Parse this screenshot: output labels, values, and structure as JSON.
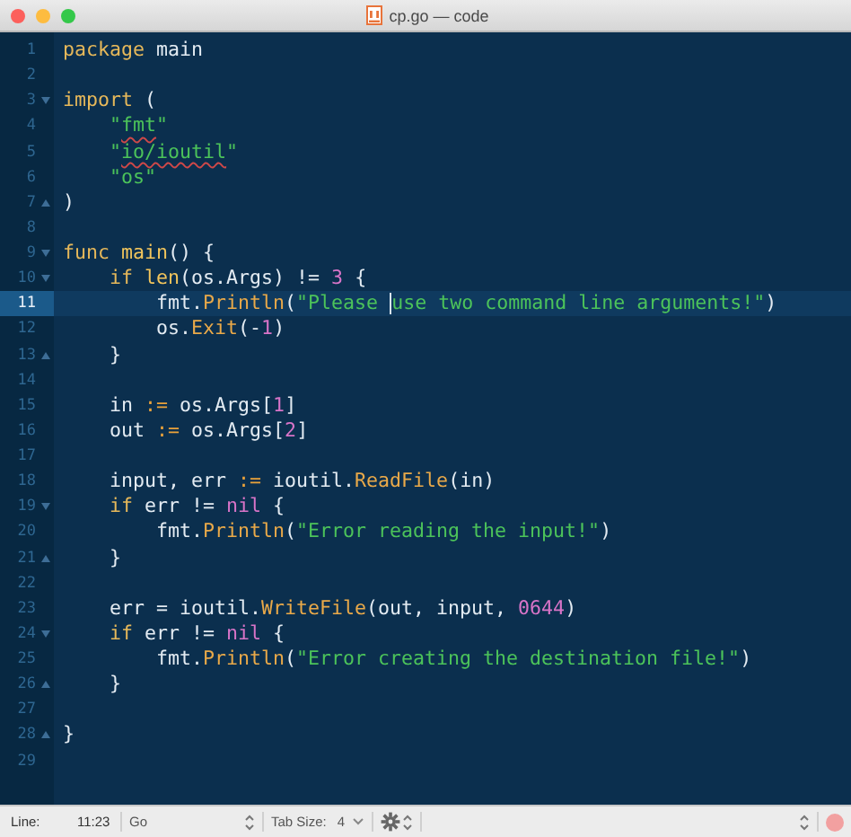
{
  "window": {
    "title": "cp.go — code",
    "controls": [
      {
        "kind": "close"
      },
      {
        "kind": "minimize"
      },
      {
        "kind": "zoom"
      }
    ]
  },
  "editor": {
    "lines": [
      {
        "number": "1",
        "selected": false,
        "tokens": [
          {
            "kind": "keyword",
            "text": "package"
          },
          {
            "kind": "plain",
            "text": " main"
          }
        ]
      },
      {
        "number": "2",
        "selected": false
      },
      {
        "number": "3",
        "selected": false,
        "fold_marker": {
          "kind": "start"
        },
        "tokens": [
          {
            "kind": "keyword",
            "text": "import"
          },
          {
            "kind": "plain",
            "text": " ("
          }
        ]
      },
      {
        "number": "4",
        "selected": false,
        "tokens": [
          {
            "kind": "string",
            "text": "    \""
          },
          {
            "kind": "string-flagged",
            "text": "fmt"
          },
          {
            "kind": "string",
            "text": "\""
          }
        ]
      },
      {
        "number": "5",
        "selected": false,
        "tokens": [
          {
            "kind": "string",
            "text": "    \""
          },
          {
            "kind": "string-flagged",
            "text": "io/ioutil"
          },
          {
            "kind": "string",
            "text": "\""
          }
        ]
      },
      {
        "number": "6",
        "selected": false,
        "tokens": [
          {
            "kind": "string",
            "text": "    \"os\""
          }
        ]
      },
      {
        "number": "7",
        "selected": false,
        "fold_marker": {
          "kind": "end"
        },
        "tokens": [
          {
            "kind": "plain",
            "text": ")"
          }
        ]
      },
      {
        "number": "8",
        "selected": false
      },
      {
        "number": "9",
        "selected": false,
        "fold_marker": {
          "kind": "start"
        },
        "tokens": [
          {
            "kind": "keyword",
            "text": "func"
          },
          {
            "kind": "function",
            "text": " main"
          },
          {
            "kind": "plain",
            "text": "() {"
          }
        ]
      },
      {
        "number": "10",
        "selected": false,
        "fold_marker": {
          "kind": "start"
        },
        "tokens": [
          {
            "kind": "keyword",
            "text": "    if"
          },
          {
            "kind": "function",
            "text": " len"
          },
          {
            "kind": "plain",
            "text": "(os.Args) != "
          },
          {
            "kind": "number",
            "text": "3"
          },
          {
            "kind": "plain",
            "text": " {"
          }
        ]
      },
      {
        "number": "11",
        "selected": true,
        "tokens": [
          {
            "kind": "plain",
            "text": "        fmt."
          },
          {
            "kind": "call",
            "text": "Println"
          },
          {
            "kind": "plain",
            "text": "("
          },
          {
            "kind": "string",
            "text": "\"Please "
          },
          {
            "kind": "caret"
          },
          {
            "kind": "string",
            "text": "use two command line arguments!\""
          },
          {
            "kind": "plain",
            "text": ")"
          }
        ]
      },
      {
        "number": "12",
        "selected": false,
        "tokens": [
          {
            "kind": "plain",
            "text": "        os."
          },
          {
            "kind": "call",
            "text": "Exit"
          },
          {
            "kind": "plain",
            "text": "(-"
          },
          {
            "kind": "number",
            "text": "1"
          },
          {
            "kind": "plain",
            "text": ")"
          }
        ]
      },
      {
        "number": "13",
        "selected": false,
        "fold_marker": {
          "kind": "end"
        },
        "tokens": [
          {
            "kind": "plain",
            "text": "    }"
          }
        ]
      },
      {
        "number": "14",
        "selected": false
      },
      {
        "number": "15",
        "selected": false,
        "tokens": [
          {
            "kind": "plain",
            "text": "    in "
          },
          {
            "kind": "operator",
            "text": ":="
          },
          {
            "kind": "plain",
            "text": " os.Args["
          },
          {
            "kind": "number",
            "text": "1"
          },
          {
            "kind": "plain",
            "text": "]"
          }
        ]
      },
      {
        "number": "16",
        "selected": false,
        "tokens": [
          {
            "kind": "plain",
            "text": "    out "
          },
          {
            "kind": "operator",
            "text": ":="
          },
          {
            "kind": "plain",
            "text": " os.Args["
          },
          {
            "kind": "number",
            "text": "2"
          },
          {
            "kind": "plain",
            "text": "]"
          }
        ]
      },
      {
        "number": "17",
        "selected": false
      },
      {
        "number": "18",
        "selected": false,
        "tokens": [
          {
            "kind": "plain",
            "text": "    input, err "
          },
          {
            "kind": "operator",
            "text": ":="
          },
          {
            "kind": "plain",
            "text": " ioutil."
          },
          {
            "kind": "call",
            "text": "ReadFile"
          },
          {
            "kind": "plain",
            "text": "(in)"
          }
        ]
      },
      {
        "number": "19",
        "selected": false,
        "fold_marker": {
          "kind": "start"
        },
        "tokens": [
          {
            "kind": "keyword",
            "text": "    if"
          },
          {
            "kind": "plain",
            "text": " err != "
          },
          {
            "kind": "number",
            "text": "nil"
          },
          {
            "kind": "plain",
            "text": " {"
          }
        ]
      },
      {
        "number": "20",
        "selected": false,
        "tokens": [
          {
            "kind": "plain",
            "text": "        fmt."
          },
          {
            "kind": "call",
            "text": "Println"
          },
          {
            "kind": "plain",
            "text": "("
          },
          {
            "kind": "string",
            "text": "\"Error reading the input!\""
          },
          {
            "kind": "plain",
            "text": ")"
          }
        ]
      },
      {
        "number": "21",
        "selected": false,
        "fold_marker": {
          "kind": "end"
        },
        "tokens": [
          {
            "kind": "plain",
            "text": "    }"
          }
        ]
      },
      {
        "number": "22",
        "selected": false
      },
      {
        "number": "23",
        "selected": false,
        "tokens": [
          {
            "kind": "plain",
            "text": "    err = ioutil."
          },
          {
            "kind": "call",
            "text": "WriteFile"
          },
          {
            "kind": "plain",
            "text": "(out, input, "
          },
          {
            "kind": "number",
            "text": "0644"
          },
          {
            "kind": "plain",
            "text": ")"
          }
        ]
      },
      {
        "number": "24",
        "selected": false,
        "fold_marker": {
          "kind": "start"
        },
        "tokens": [
          {
            "kind": "keyword",
            "text": "    if"
          },
          {
            "kind": "plain",
            "text": " err != "
          },
          {
            "kind": "number",
            "text": "nil"
          },
          {
            "kind": "plain",
            "text": " {"
          }
        ]
      },
      {
        "number": "25",
        "selected": false,
        "tokens": [
          {
            "kind": "plain",
            "text": "        fmt."
          },
          {
            "kind": "call",
            "text": "Println"
          },
          {
            "kind": "plain",
            "text": "("
          },
          {
            "kind": "string",
            "text": "\"Error creating the destination file!\""
          },
          {
            "kind": "plain",
            "text": ")"
          }
        ]
      },
      {
        "number": "26",
        "selected": false,
        "fold_marker": {
          "kind": "end"
        },
        "tokens": [
          {
            "kind": "plain",
            "text": "    }"
          }
        ]
      },
      {
        "number": "27",
        "selected": false
      },
      {
        "number": "28",
        "selected": false,
        "fold_marker": {
          "kind": "end"
        },
        "tokens": [
          {
            "kind": "plain",
            "text": "}"
          }
        ]
      },
      {
        "number": "29",
        "selected": false
      }
    ]
  },
  "status_bar": {
    "line_label": "Line:",
    "position": "11:23",
    "syntax": "Go",
    "tab_size_label": "Tab Size:",
    "tab_size": "4"
  }
}
